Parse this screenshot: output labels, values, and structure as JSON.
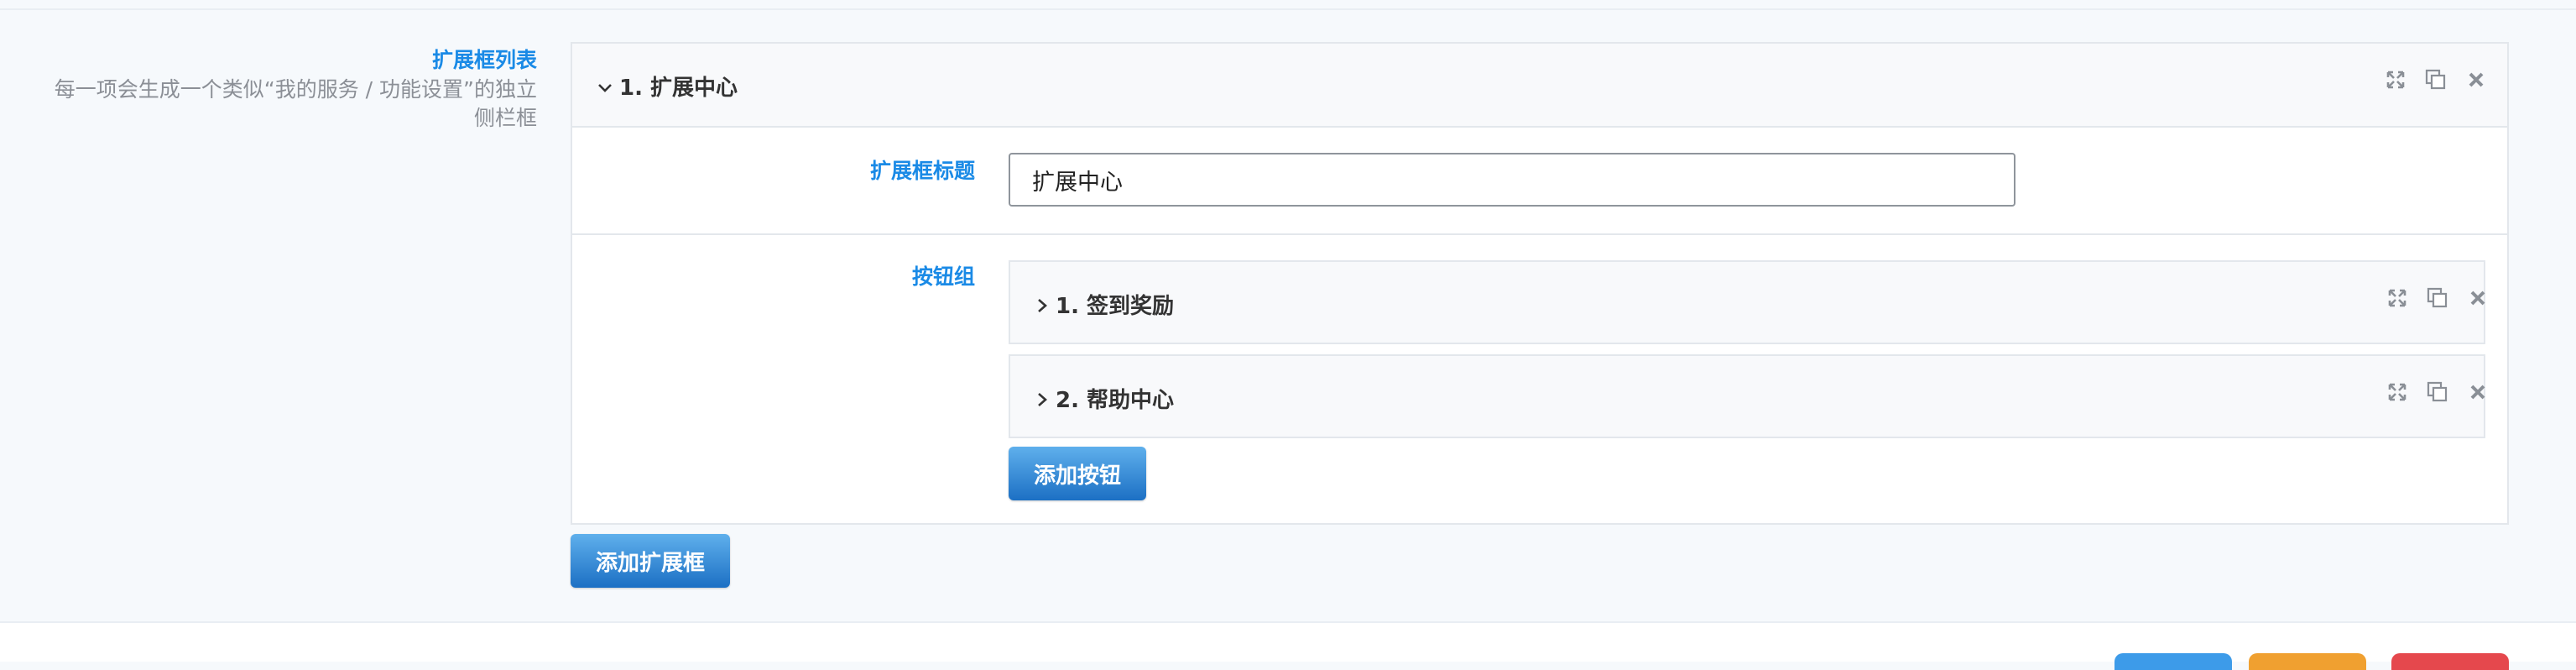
{
  "section": {
    "label": "扩展框列表",
    "description": "每一项会生成一个类似“我的服务 / 功能设置”的独立侧栏框"
  },
  "panel": {
    "title": "1. 扩展中心",
    "title_label": "扩展框标题",
    "title_value": "扩展中心",
    "buttons_label": "按钮组",
    "buttons": [
      {
        "title": "1. 签到奖励"
      },
      {
        "title": "2. 帮助中心"
      }
    ],
    "add_button_label": "添加按钮"
  },
  "add_panel_label": "添加扩展框",
  "colors": {
    "accent": "#1a8ae6",
    "button_top": "#5fb0ec",
    "button_bottom": "#1c70c4",
    "pill_blue": "#3d9be9",
    "pill_orange": "#f0a030",
    "pill_red": "#e5484d"
  },
  "icons": {
    "expand": "expand-icon",
    "copy": "copy-icon",
    "close": "close-icon",
    "collapse": "chevron-down-icon",
    "expand_row": "chevron-right-icon"
  }
}
